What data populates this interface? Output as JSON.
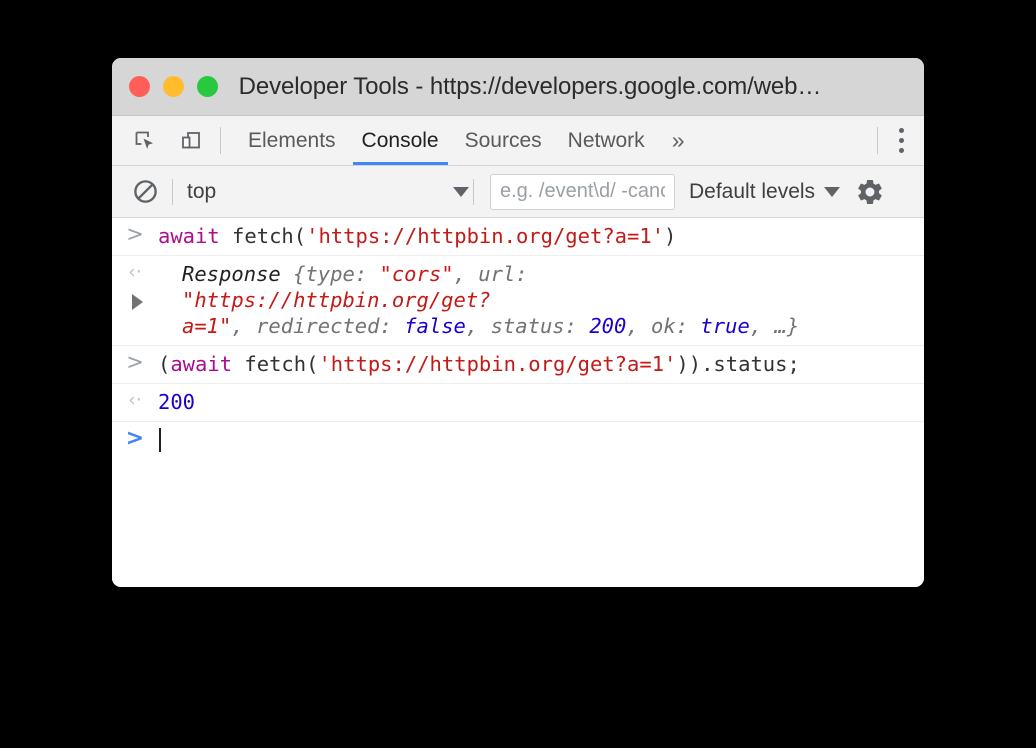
{
  "window": {
    "title": "Developer Tools - https://developers.google.com/web…",
    "traffic_lights": [
      {
        "name": "close",
        "color": "#ff5f57"
      },
      {
        "name": "minimize",
        "color": "#ffbd2e"
      },
      {
        "name": "zoom",
        "color": "#28c840"
      }
    ]
  },
  "tabbar": {
    "icons": [
      {
        "name": "inspect-element-icon"
      },
      {
        "name": "device-toolbar-icon"
      }
    ],
    "tabs": [
      {
        "label": "Elements",
        "active": false
      },
      {
        "label": "Console",
        "active": true
      },
      {
        "label": "Sources",
        "active": false
      },
      {
        "label": "Network",
        "active": false
      }
    ],
    "more_tabs_label": "»",
    "menu_label": "more-options",
    "active_underline_color": "#4285f4"
  },
  "console_toolbar": {
    "clear_icon": "clear-console-icon",
    "context": {
      "selected": "top",
      "caret": "▼"
    },
    "filter": {
      "value": "",
      "placeholder": "e.g. /event\\d/ -cancelled"
    },
    "levels": {
      "label": "Default levels",
      "caret": "▼"
    },
    "settings_icon": "gear-icon"
  },
  "console": {
    "entries": [
      {
        "type": "input",
        "marker": ">",
        "segments": [
          {
            "text": "await",
            "style": "kw"
          },
          {
            "text": " fetch(",
            "style": "plain"
          },
          {
            "text": "'https://httpbin.org/get?a=1'",
            "style": "str"
          },
          {
            "text": ")",
            "style": "plain"
          }
        ]
      },
      {
        "type": "output",
        "marker": "‹·",
        "expandable": true,
        "line1": [
          {
            "text": "Response ",
            "style": "objname"
          },
          {
            "text": "{",
            "style": "prop"
          },
          {
            "text": "type",
            "style": "prop"
          },
          {
            "text": ": ",
            "style": "prop"
          },
          {
            "text": "\"cors\"",
            "style": "str"
          },
          {
            "text": ", ",
            "style": "prop"
          },
          {
            "text": "url",
            "style": "prop"
          },
          {
            "text": ":",
            "style": "prop"
          }
        ],
        "line2": [
          {
            "text": "\"https://httpbin.org/get?",
            "style": "str"
          }
        ],
        "line3": [
          {
            "text": "a=1\"",
            "style": "str"
          },
          {
            "text": ", ",
            "style": "prop"
          },
          {
            "text": "redirected",
            "style": "prop"
          },
          {
            "text": ": ",
            "style": "prop"
          },
          {
            "text": "false",
            "style": "bool"
          },
          {
            "text": ", ",
            "style": "prop"
          },
          {
            "text": "status",
            "style": "prop"
          },
          {
            "text": ": ",
            "style": "prop"
          },
          {
            "text": "200",
            "style": "num"
          },
          {
            "text": ", ",
            "style": "prop"
          },
          {
            "text": "ok",
            "style": "prop"
          },
          {
            "text": ": ",
            "style": "prop"
          },
          {
            "text": "true",
            "style": "bool"
          },
          {
            "text": ", …}",
            "style": "prop"
          }
        ]
      },
      {
        "type": "input",
        "marker": ">",
        "segments": [
          {
            "text": "(",
            "style": "plain"
          },
          {
            "text": "await",
            "style": "kw"
          },
          {
            "text": " fetch(",
            "style": "plain"
          },
          {
            "text": "'https://httpbin.org/get?a=1'",
            "style": "str"
          },
          {
            "text": ")).status;",
            "style": "plain"
          }
        ]
      },
      {
        "type": "output",
        "marker": "‹·",
        "simple": {
          "text": "200",
          "style": "num"
        }
      },
      {
        "type": "prompt",
        "marker": ">",
        "value": ""
      }
    ]
  }
}
